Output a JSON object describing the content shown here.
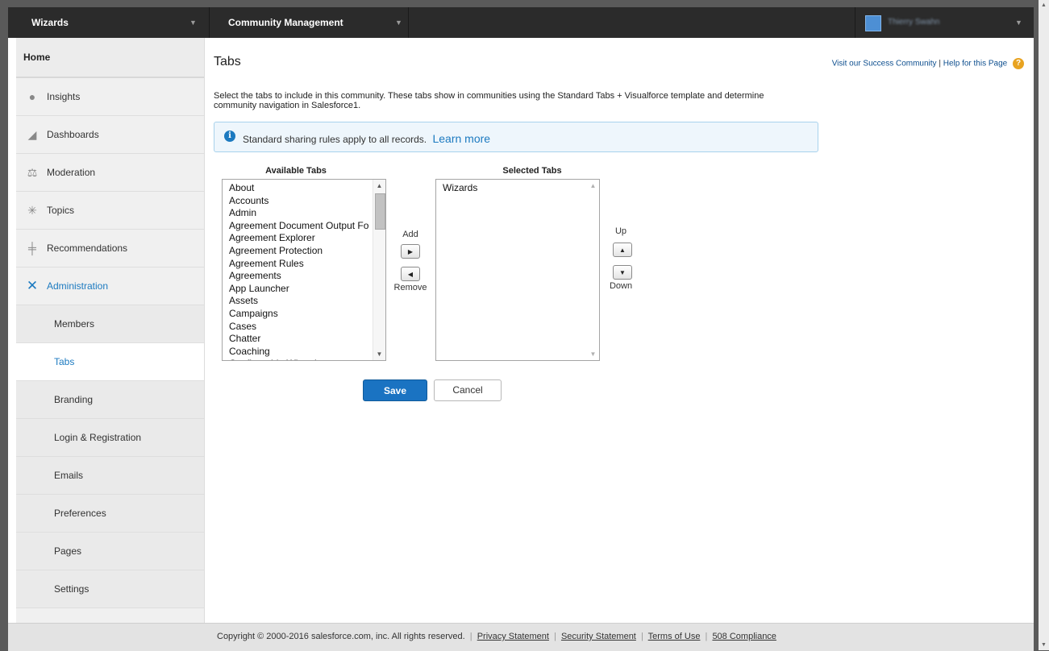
{
  "topbar": {
    "left_menu": "Wizards",
    "center_menu": "Community Management",
    "user_name": "Thierry Swahn"
  },
  "sidebar": {
    "home": "Home",
    "items": [
      {
        "label": "Insights",
        "icon": "lightbulb-icon"
      },
      {
        "label": "Dashboards",
        "icon": "chart-icon"
      },
      {
        "label": "Moderation",
        "icon": "scales-icon"
      },
      {
        "label": "Topics",
        "icon": "topics-icon"
      },
      {
        "label": "Recommendations",
        "icon": "signpost-icon"
      },
      {
        "label": "Administration",
        "icon": "wrench-icon"
      }
    ],
    "admin_sub": [
      "Members",
      "Tabs",
      "Branding",
      "Login & Registration",
      "Emails",
      "Preferences",
      "Pages",
      "Settings"
    ],
    "active_sub": "Tabs",
    "accent_color": "#1c7ac0"
  },
  "main": {
    "title": "Tabs",
    "success_link": "Visit our Success Community",
    "link_separator": "|",
    "help_link": "Help for this Page",
    "description": "Select the tabs to include in this community. These tabs show in communities using the Standard Tabs + Visualforce template and determine community navigation in Salesforce1.",
    "info_text": "Standard sharing rules apply to all records.",
    "info_link": "Learn more",
    "available_header": "Available Tabs",
    "selected_header": "Selected Tabs",
    "available_tabs": [
      "About",
      "Accounts",
      "Admin",
      "Agreement Document Output Fo",
      "Agreement Explorer",
      "Agreement Protection",
      "Agreement Rules",
      "Agreements",
      "App Launcher",
      "Assets",
      "Campaigns",
      "Cases",
      "Chatter",
      "Coaching",
      "Configurable Wizards"
    ],
    "selected_tabs": [
      "Wizards"
    ],
    "add_label": "Add",
    "remove_label": "Remove",
    "up_label": "Up",
    "down_label": "Down",
    "save_label": "Save",
    "cancel_label": "Cancel"
  },
  "footer": {
    "copyright": "Copyright © 2000-2016 salesforce.com, inc. All rights reserved.",
    "links": [
      "Privacy Statement",
      "Security Statement",
      "Terms of Use",
      "508 Compliance"
    ]
  }
}
